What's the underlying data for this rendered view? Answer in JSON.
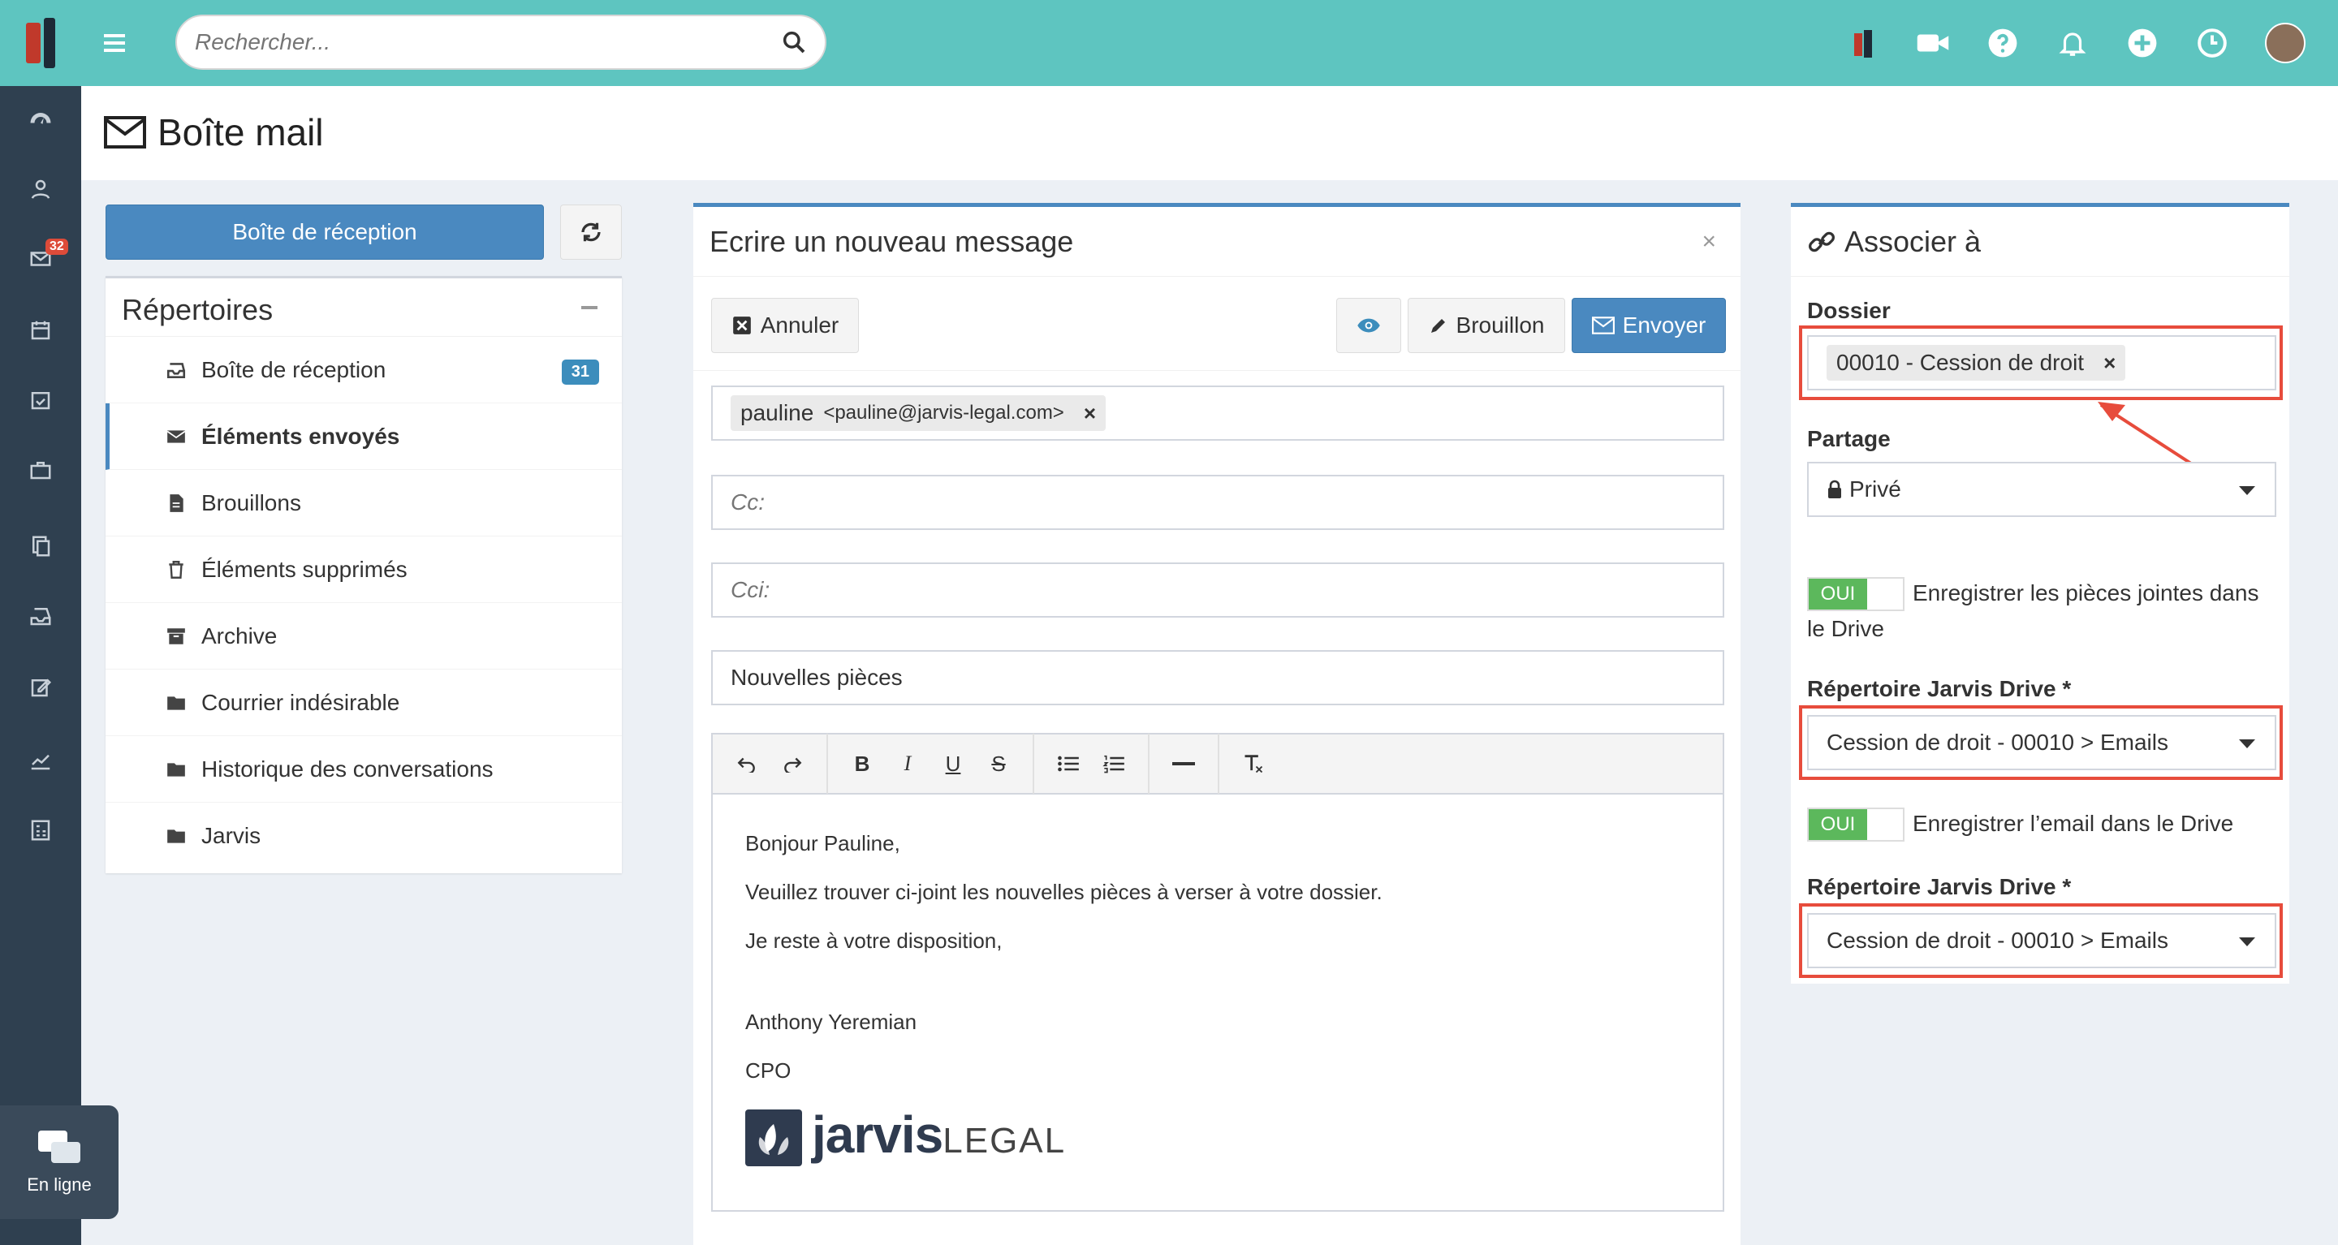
{
  "header": {
    "search_placeholder": "Rechercher..."
  },
  "page": {
    "title": "Boîte mail"
  },
  "left": {
    "inbox_button": "Boîte de réception",
    "directories_title": "Répertoires",
    "items": [
      {
        "label": "Boîte de réception",
        "badge": "31"
      },
      {
        "label": "Éléments envoyés"
      },
      {
        "label": "Brouillons"
      },
      {
        "label": "Éléments supprimés"
      },
      {
        "label": "Archive"
      },
      {
        "label": "Courrier indésirable"
      },
      {
        "label": "Historique des conversations"
      },
      {
        "label": "Jarvis"
      }
    ]
  },
  "sidebar": {
    "mail_badge": "32"
  },
  "chat": {
    "label": "En ligne"
  },
  "compose": {
    "title": "Ecrire un nouveau message",
    "close": "×",
    "cancel_label": "Annuler",
    "draft_label": "Brouillon",
    "send_label": "Envoyer",
    "to_name": "pauline",
    "to_email": "<pauline@jarvis-legal.com>",
    "tag_remove": "×",
    "cc_placeholder": "Cc:",
    "bcc_placeholder": "Cci:",
    "subject": "Nouvelles pièces",
    "body": {
      "line1": "Bonjour Pauline,",
      "line2": "Veuillez trouver ci-joint les nouvelles pièces à verser à votre dossier.",
      "line3": "Je reste à votre disposition,",
      "sig_name": "Anthony Yeremian",
      "sig_role": "CPO",
      "logo_main": "jarvis",
      "logo_sub": "LEGAL"
    }
  },
  "assoc": {
    "title": "Associer à",
    "dossier_label": "Dossier",
    "dossier_value": "00010 - Cession de droit",
    "dossier_remove": "×",
    "partage_label": "Partage",
    "partage_value": "Privé",
    "toggle1_on": "OUI",
    "toggle1_text": "Enregistrer les pièces jointes dans le Drive",
    "drive1_label": "Répertoire Jarvis Drive *",
    "drive1_value": "Cession de droit - 00010 > Emails",
    "toggle2_on": "OUI",
    "toggle2_text": "Enregistrer l’email dans le Drive",
    "drive2_label": "Répertoire Jarvis Drive *",
    "drive2_value": "Cession de droit - 00010 > Emails"
  },
  "colors": {
    "teal": "#5ec5c0",
    "sidebar": "#2f4050",
    "primary": "#4a89c0",
    "highlight": "#e74c3c",
    "toggle_on": "#5cb85c"
  }
}
